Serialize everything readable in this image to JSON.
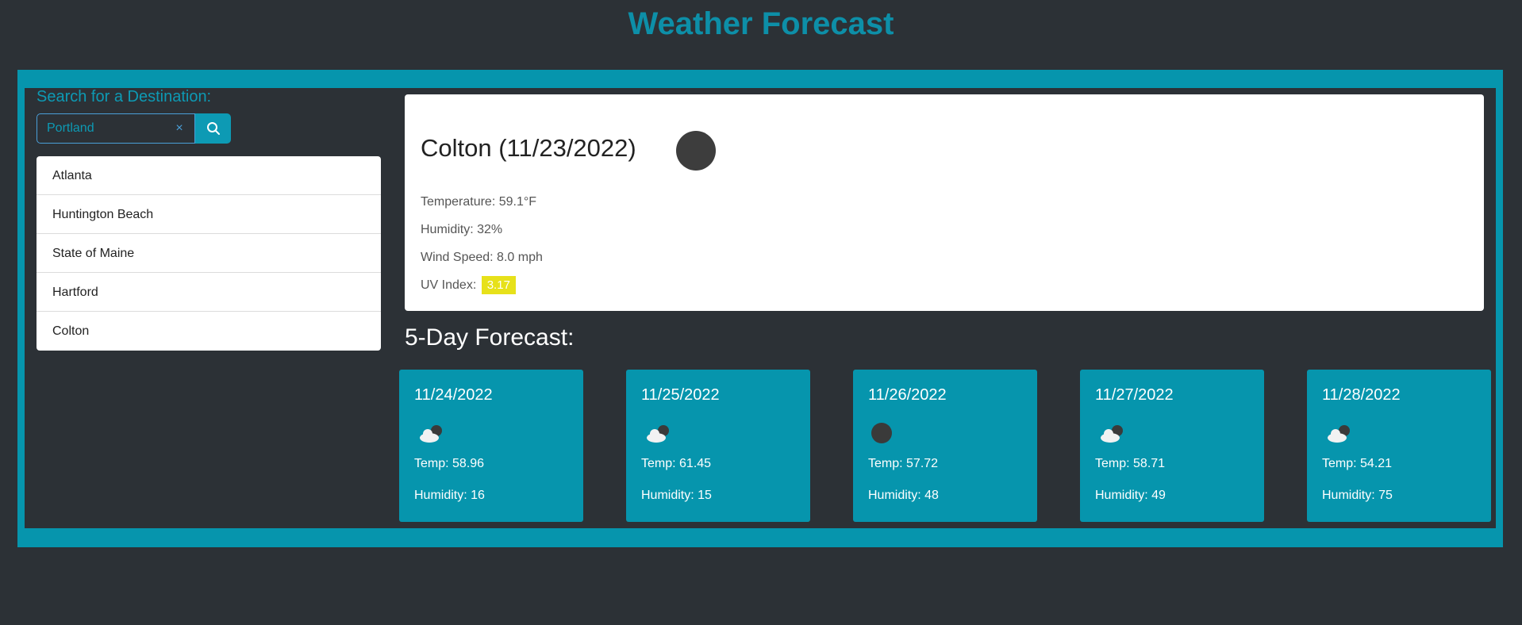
{
  "header": {
    "title": "Weather Forecast"
  },
  "search": {
    "label": "Search for a Destination:",
    "value": "Portland",
    "clear_icon": "×",
    "button_icon": "search-icon"
  },
  "history": [
    "Atlanta",
    "Huntington Beach",
    "State of Maine",
    "Hartford",
    "Colton"
  ],
  "current": {
    "city_title": "Colton (11/23/2022)",
    "icon": "dark-circle-icon",
    "temperature": "Temperature: 59.1°F",
    "humidity": "Humidity: 32%",
    "wind": "Wind Speed: 8.0 mph",
    "uv_label": "UV Index:",
    "uv_value": "3.17",
    "uv_color": "#e7e11a"
  },
  "forecast": {
    "heading": "5-Day Forecast:",
    "days": [
      {
        "date": "11/24/2022",
        "icon": "cloud-icon",
        "temp": "Temp: 58.96",
        "humidity": "Humidity: 16"
      },
      {
        "date": "11/25/2022",
        "icon": "cloud-icon",
        "temp": "Temp: 61.45",
        "humidity": "Humidity: 15"
      },
      {
        "date": "11/26/2022",
        "icon": "dark-circle-icon",
        "temp": "Temp: 57.72",
        "humidity": "Humidity: 48"
      },
      {
        "date": "11/27/2022",
        "icon": "cloud-icon",
        "temp": "Temp: 58.71",
        "humidity": "Humidity: 49"
      },
      {
        "date": "11/28/2022",
        "icon": "cloud-icon",
        "temp": "Temp: 54.21",
        "humidity": "Humidity: 75"
      }
    ]
  },
  "colors": {
    "accent": "#0695ad",
    "background": "#2c3136",
    "title": "#0d8fa8"
  }
}
